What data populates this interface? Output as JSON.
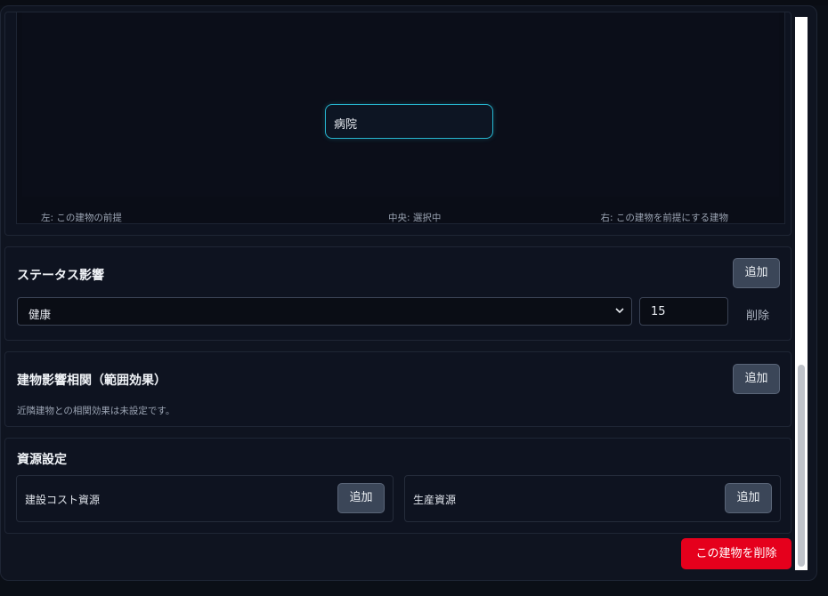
{
  "graph": {
    "selected_node": "病院",
    "legend_left": "左: この建物の前提",
    "legend_center": "中央: 選択中",
    "legend_right": "右: この建物を前提にする建物"
  },
  "status_effects": {
    "title": "ステータス影響",
    "add_label": "追加",
    "rows": [
      {
        "status": "健康",
        "value": "15",
        "delete_label": "削除"
      }
    ]
  },
  "building_influence": {
    "title": "建物影響相関（範囲効果）",
    "add_label": "追加",
    "empty_text": "近隣建物との相関効果は未設定です。"
  },
  "resource_settings": {
    "title": "資源設定",
    "build_cost": {
      "label": "建設コスト資源",
      "add_label": "追加"
    },
    "production": {
      "label": "生産資源",
      "add_label": "追加"
    }
  },
  "footer": {
    "delete_building_label": "この建物を削除"
  },
  "colors": {
    "accent_cyan": "#27b6d0",
    "danger_red": "#e5001c",
    "button_gray": "#3b4658"
  }
}
